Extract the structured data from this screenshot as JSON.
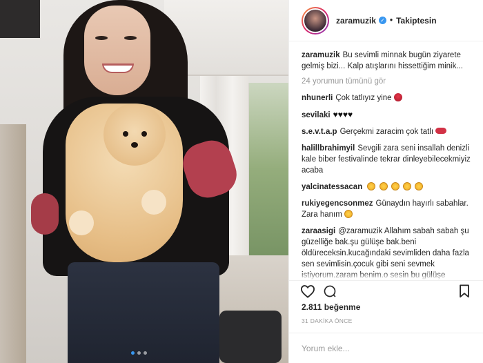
{
  "header": {
    "username": "zaramuzik",
    "verified_mark": "✓",
    "separator": "•",
    "follow_status": "Takiptesin"
  },
  "caption": {
    "username": "zaramuzik",
    "text": "Bu sevimli minnak bugün ziyarete gelmiş bizi... Kalp atışlarını hissettiğim minik..."
  },
  "more_comments": "24 yorumun tümünü gör",
  "comments": [
    {
      "username": "nhunerli",
      "text": "Çok tatlıyız yine",
      "emoji": "rose"
    },
    {
      "username": "sevilaki",
      "text": "♥♥♥♥",
      "emoji": ""
    },
    {
      "username": "s.e.v.t.a.p",
      "text": "Gerçekmi zaracim çok tatlı",
      "emoji": "lips"
    },
    {
      "username": "halillbrahimyil",
      "text": "Sevgili zara seni insallah denizli kale biber festivalinde tekrar dinleyebilecekmiyiz acaba",
      "emoji": ""
    },
    {
      "username": "yalcinatessacan",
      "text": "",
      "emoji": "faces"
    },
    {
      "username": "rukiyegencsonmez",
      "text": "Günaydın hayırlı sabahlar. Zara hanım",
      "emoji": "wink"
    },
    {
      "username": "zaraasigi",
      "text": "@zaramuzik Allahım sabah sabah şu güzelliğe bak.şu gülüşe bak.beni öldüreceksin.kucağındaki sevimliden daha fazla sen sevimlisin.çocuk gibi seni sevmek istiyorum.zaram benim.o sesin bu gülüşe",
      "emoji": ""
    }
  ],
  "likes": "2.811 beğenme",
  "time": "31 DAKİKA ÖNCE",
  "add_comment": {
    "placeholder": "Yorum ekle..."
  },
  "colors": {
    "link": "#3897f0",
    "muted": "#999999",
    "text": "#262626"
  },
  "icons": [
    "heart-icon",
    "comment-icon",
    "bookmark-icon",
    "verified-icon"
  ]
}
